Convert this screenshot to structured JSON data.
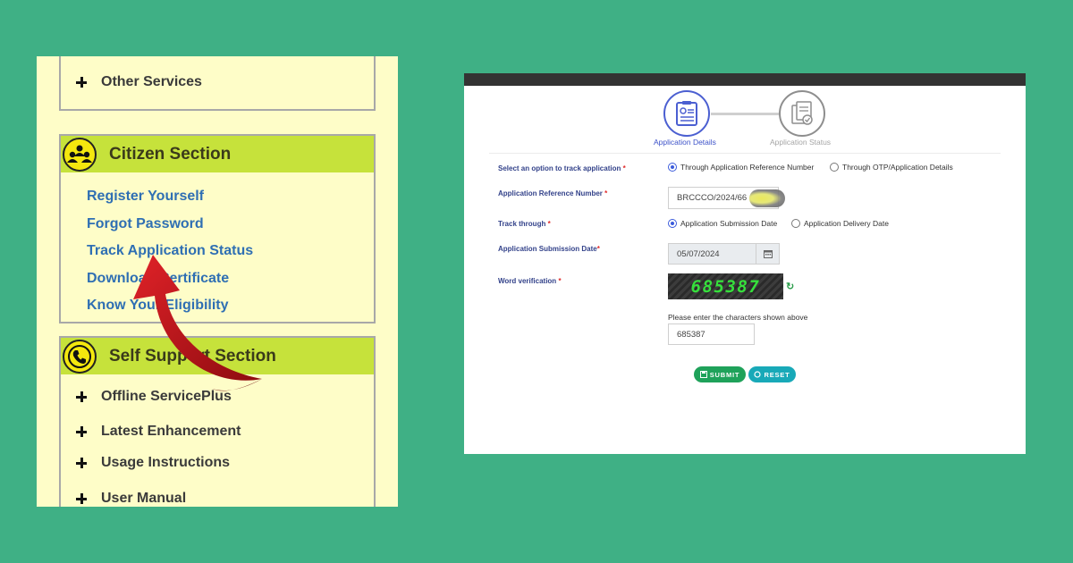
{
  "left_menu": {
    "other_services": "Other Services",
    "citizen_section": {
      "title": "Citizen Section",
      "links": [
        "Register Yourself",
        "Forgot Password",
        "Track Application Status",
        "Download Certificate",
        "Know Your Eligibility"
      ]
    },
    "self_support_section": {
      "title": "Self Support Section",
      "items": [
        "Offline ServicePlus",
        "Latest Enhancement",
        "Usage Instructions",
        "User Manual"
      ]
    }
  },
  "form": {
    "steps": [
      "Application Details",
      "Application Status"
    ],
    "option_label": "Select an option to track application",
    "option_choices": [
      "Through Application Reference Number",
      "Through OTP/Application Details"
    ],
    "option_selected": "Through Application Reference Number",
    "ref_label": "Application Reference Number",
    "ref_value": "BRCCCO/2024/66",
    "track_label": "Track through",
    "track_choices": [
      "Application Submission Date",
      "Application Delivery Date"
    ],
    "track_selected": "Application Submission Date",
    "date_label": "Application Submission Date",
    "date_value": "05/07/2024",
    "word_label": "Word verification",
    "captcha_text": "685387",
    "captcha_hint": "Please enter the characters shown above",
    "captcha_value": "685387",
    "submit_label": "SUBMIT",
    "reset_label": "RESET",
    "required_mark": "*"
  },
  "colors": {
    "background": "#3fb085",
    "section_header": "#c6e23b",
    "panel": "#fefdc8",
    "link": "#2f6fb3",
    "arrow": "#c8141c",
    "step_active": "#4b5fd1",
    "submit": "#1fa25a",
    "reset": "#18a9b8"
  }
}
